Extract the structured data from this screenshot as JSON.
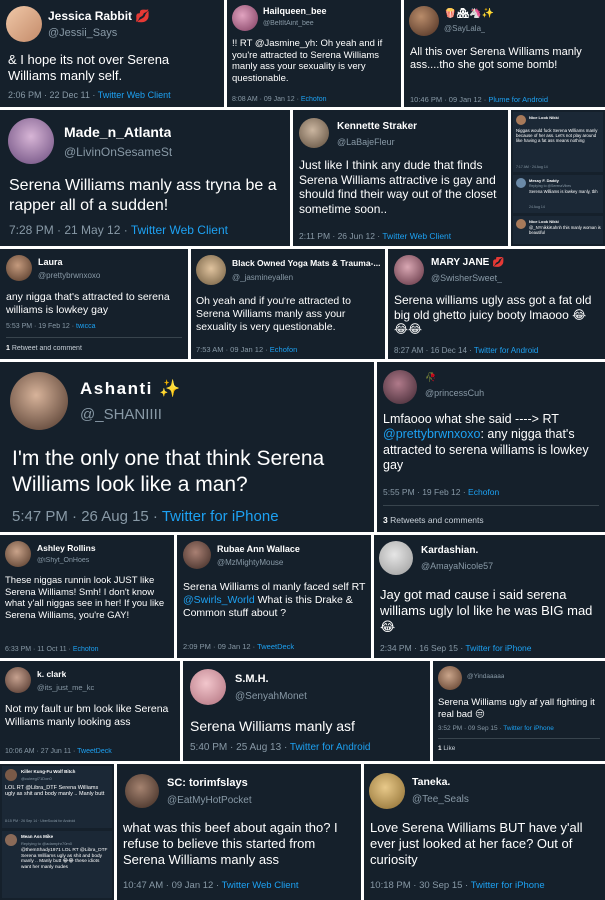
{
  "tweets": [
    {
      "name": "Jessica Rabbit 💋",
      "handle": "@Jessii_Says",
      "text": "& I hope its not over Serena Williams manly self.",
      "time": "2:06 PM · 22 Dec 11 · ",
      "source": "Twitter Web Client"
    },
    {
      "name": "Hailqueen_bee",
      "handle": "@BeltItAint_bee",
      "text": "!! RT @Jasmine_yh: Oh yeah and if you're attracted to Serena Williams manly ass your sexuality is very questionable.",
      "time": "8:08 AM · 09 Jan 12 · ",
      "source": "Echofon"
    },
    {
      "name": "🍿🏘🦄✨",
      "handle": "@SayLala_",
      "text": "All this over Serena Williams manly ass....tho she got some bomb!",
      "time": "10:46 PM · 09 Jan 12 · ",
      "source": "Plume for Android"
    },
    {
      "name": "Made_n_Atlanta",
      "handle": "@LivinOnSesameSt",
      "text": "Serena Williams manly ass tryna be a rapper all of a sudden!",
      "time": "7:28 PM · 21 May 12 · ",
      "source": "Twitter Web Client"
    },
    {
      "name": "Kennette Straker",
      "handle": "@LaBajeFleur",
      "text": "Just like I think any dude that finds Serena Williams attractive is gay and should find their way out of the closet sometime soon..",
      "time": "2:11 PM · 26 Jun 12 · ",
      "source": "Twitter Web Client"
    },
    {
      "name": "Laura",
      "handle": "@prettybrwnxoxo",
      "text": "any nigga that's attracted to serena williams is lowkey gay",
      "time": "5:53 PM · 19 Feb 12 · ",
      "source": "twicca",
      "footer_count": "1",
      "footer_label": " Retweet and comment"
    },
    {
      "name": "Black Owned Yoga Mats & Trauma-...",
      "handle": "@_jasmineyallen",
      "text": "Oh yeah and if you're attracted to Serena Williams manly ass your sexuality is very questionable.",
      "time": "7:53 AM · 09 Jan 12 · ",
      "source": "Echofon"
    },
    {
      "name": "MARY JANE 💋",
      "handle": "@SwisherSweet_",
      "text": "Serena williams ugly ass got a fat old big old ghetto juicy booty lmaooo 😂😂😂",
      "time": "8:27 AM · 16 Dec 14 · ",
      "source": "Twitter for Android"
    },
    {
      "name": "Ashanti ✨",
      "handle": "@_SHANIIII",
      "text": "I'm the only one that think Serena Williams look like a man?",
      "time": "5:47 PM · 26 Aug 15 · ",
      "source": "Twitter for iPhone"
    },
    {
      "name": "🥀",
      "handle": "@princessCuh",
      "text_a": "Lmfaooo what she said ----> RT ",
      "text_b": "@prettybrwnxoxo",
      "text_c": ": any nigga that's attracted to serena williams is lowkey gay",
      "time": "5:55 PM · 19 Feb 12 · ",
      "source": "Echofon",
      "footer_count": "3",
      "footer_label": " Retweets and comments"
    },
    {
      "name": "Ashley Rollins",
      "handle": "@iShyt_OnHoes",
      "text": "These niggas runnin look JUST like Serena Williams! Smh! I don't know what y'all niggas see in her! If you like Serena Williams, you're GAY!",
      "time": "6:33 PM · 11 Oct 11 · ",
      "source": "Echofon"
    },
    {
      "name": "Rubae Ann Wallace",
      "handle": "@MzMightyMouse",
      "text_a": "Serena Williams ol manly faced self RT ",
      "text_b": "@Swirls_World",
      "text_c": " What is this Drake & Common stuff about ?",
      "time": "2:09 PM · 09 Jan 12 · ",
      "source": "TweetDeck"
    },
    {
      "name": "Kardashian.",
      "handle": "@AmayaNicole57",
      "text": "Jay got mad cause i said serena williams ugly lol like he was BIG mad 😂",
      "time": "2:34 PM · 16 Sep 15 · ",
      "source": "Twitter for iPhone"
    },
    {
      "name": "k. clark",
      "handle": "@its_just_me_kc",
      "text": "Not my fault ur bm look like Serena Williams manly looking ass",
      "time": "10:06 AM · 27 Jun 11 · ",
      "source": "TweetDeck"
    },
    {
      "name": "S.M.H.",
      "handle": "@SenyahMonet",
      "text": "Serena Williams manly asf",
      "time": "5:40 PM · 25 Aug 13 · ",
      "source": "Twitter for Android"
    },
    {
      "name": "",
      "handle": "@Yindaaaaa",
      "text": "Serena Williams ugly af yall fighting it real bad 😒",
      "time": "3:52 PM · 09 Sep 15 · ",
      "source": "Twitter for iPhone",
      "footer_count": "1",
      "footer_label": " Like"
    },
    {
      "name": "SC: torimfslays",
      "handle": "@EatMyHotPocket",
      "text": "what was this beef about again tho? I refuse to believe this started from Serena Williams manly ass",
      "time": "10:47 AM · 09 Jan 12 · ",
      "source": "Twitter Web Client"
    },
    {
      "name": "Taneka.",
      "handle": "@Tee_Seals",
      "text": "Love Serena Williams BUT have y'all ever just looked at her face? Out of curiosity",
      "time": "10:18 PM · 30 Sep 15 · ",
      "source": "Twitter for iPhone"
    }
  ],
  "collage_a": {
    "t1": {
      "name": "Nice Look Nikki",
      "text": "Niggas would fuck Serena Williams manly because of her ass. Let's not play around like having a fat ass means nothing",
      "time": "7:17 AM · 24 Aug 14"
    },
    "t2": {
      "name": "Messy F. Daddy",
      "reply": "Replying to @SerenaVibes",
      "text": "Serena Williams is lowkey manly, tbh",
      "time": "24 Aug 14"
    },
    "t3": {
      "name": "Nice Look Nikki",
      "text": "@_NYnikkiKahnh this manly woman is beautiful"
    }
  },
  "collage_b": {
    "t1": {
      "name": "Killer Kung-Fu Wolf Bitch",
      "handle": "@culeegl71Don0",
      "text": "LOL RT @Libra_DTF Serena Williams ugly as shit and body manly .. Manly butt",
      "time": "8:15 PM · 26 Sep 14 · UberSocial for Android"
    },
    "t2": {
      "name": "Mean Ass Mike",
      "reply": "Replying to @adamphr70m0",
      "text": "@themShady1971 LOL RT @Libra_DTF Serena Williams ugly as shit and body manly .. Manly butt 😂😂 these idiots want her manly nudes"
    }
  },
  "colors": {
    "card_bg": "#15202b",
    "text": "#ffffff",
    "muted": "#8899a6",
    "link": "#1da1f2",
    "border": "#38444d"
  }
}
